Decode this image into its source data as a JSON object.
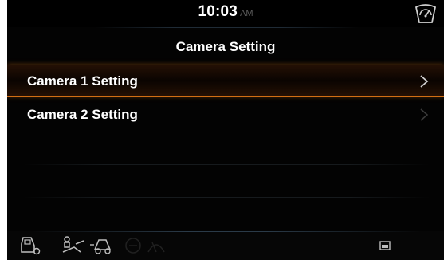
{
  "status_bar": {
    "time": "10:03",
    "ampm": "AM",
    "right_icon": "gauge-icon"
  },
  "screen": {
    "title": "Camera Setting"
  },
  "menu": {
    "items": [
      {
        "label": "Camera 1 Setting",
        "selected": true,
        "icon": "chevron-right-icon"
      },
      {
        "label": "Camera 2 Setting",
        "selected": false,
        "icon": "chevron-right-icon"
      }
    ]
  },
  "bottom_bar": {
    "left_icons": [
      "machine-status-icon",
      "operator-controls-icon",
      "auto-mode-icon",
      "work-light-icon",
      "wiper-icon"
    ],
    "right_icon": "lock-icon"
  },
  "colors": {
    "background": "#030303",
    "accent": "#d26e14",
    "text": "#ffffff",
    "muted": "#5a5a5a"
  }
}
